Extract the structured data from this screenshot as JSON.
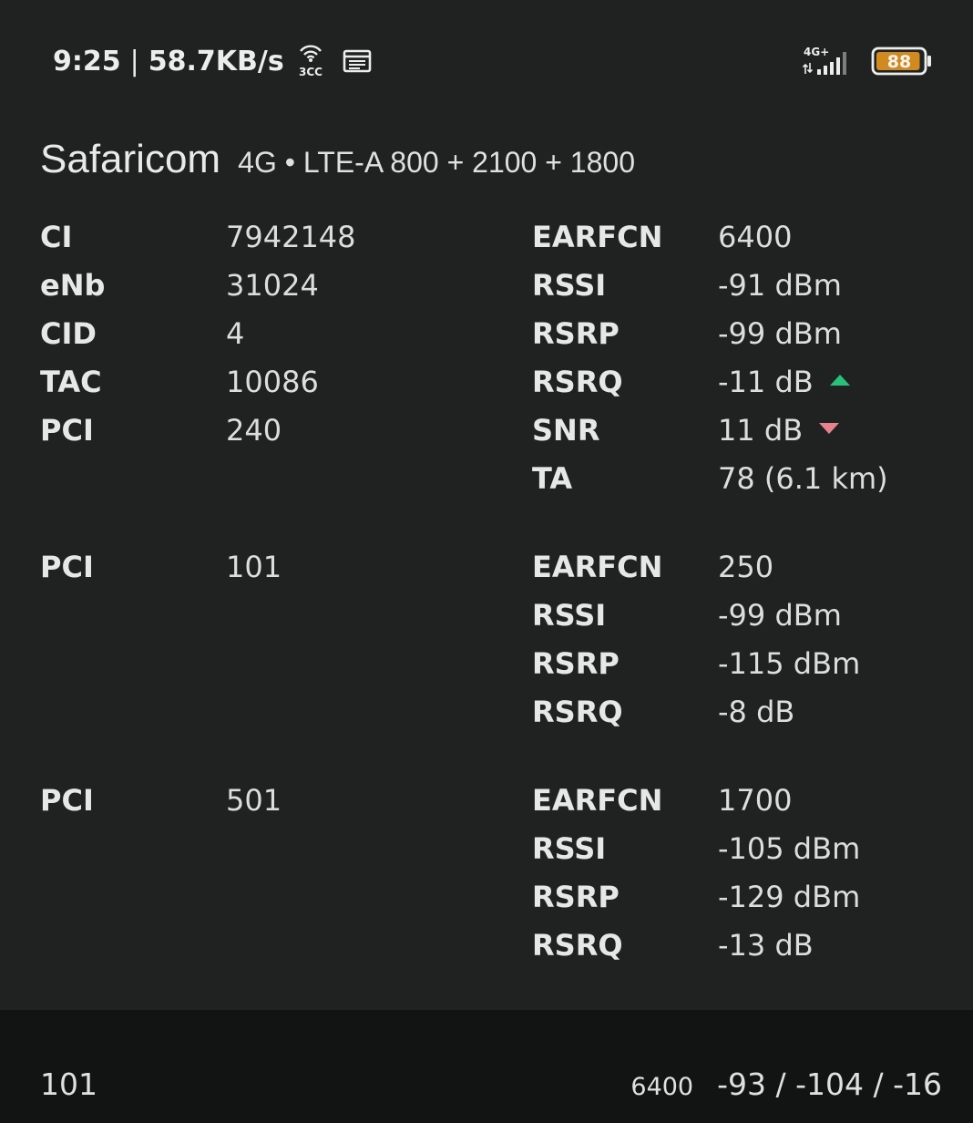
{
  "status_bar": {
    "time": "9:25",
    "separator": "|",
    "speed": "58.7KB/s",
    "hotspot_label": "3CC",
    "network_badge": "4G+",
    "battery_level": "88",
    "battery_fill": 0.88,
    "icons": [
      "hotspot-icon",
      "notification-icon",
      "signal-icon",
      "battery-icon"
    ]
  },
  "header": {
    "operator": "Safaricom",
    "network": "4G • LTE-A 800 + 2100 + 1800"
  },
  "primary_cell": {
    "left": [
      {
        "label": "CI",
        "value": "7942148"
      },
      {
        "label": "eNb",
        "value": "31024"
      },
      {
        "label": "CID",
        "value": "4"
      },
      {
        "label": "TAC",
        "value": "10086"
      },
      {
        "label": "PCI",
        "value": "240"
      }
    ],
    "right": [
      {
        "label": "EARFCN",
        "value": "6400"
      },
      {
        "label": "RSSI",
        "value": "-91 dBm"
      },
      {
        "label": "RSRP",
        "value": "-99 dBm"
      },
      {
        "label": "RSRQ",
        "value": "-11 dB",
        "trend": "up"
      },
      {
        "label": "SNR",
        "value": "11 dB",
        "trend": "down"
      },
      {
        "label": "TA",
        "value": "78 (6.1 km)"
      }
    ]
  },
  "secondary_cells": [
    {
      "pci_label": "PCI",
      "pci": "101",
      "right": [
        {
          "label": "EARFCN",
          "value": "250"
        },
        {
          "label": "RSSI",
          "value": "-99 dBm"
        },
        {
          "label": "RSRP",
          "value": "-115 dBm"
        },
        {
          "label": "RSRQ",
          "value": "-8 dB"
        }
      ]
    },
    {
      "pci_label": "PCI",
      "pci": "501",
      "right": [
        {
          "label": "EARFCN",
          "value": "1700"
        },
        {
          "label": "RSSI",
          "value": "-105 dBm"
        },
        {
          "label": "RSRP",
          "value": "-129 dBm"
        },
        {
          "label": "RSRQ",
          "value": "-13 dB"
        }
      ]
    }
  ],
  "footer": {
    "pci": "101",
    "earfcn": "6400",
    "signal": "-93 / -104 / -16"
  },
  "colors": {
    "background": "#202121",
    "footer_background": "#121414",
    "trend_up": "#27c17a",
    "trend_down": "#e8828f",
    "battery": "#d08a1e"
  }
}
